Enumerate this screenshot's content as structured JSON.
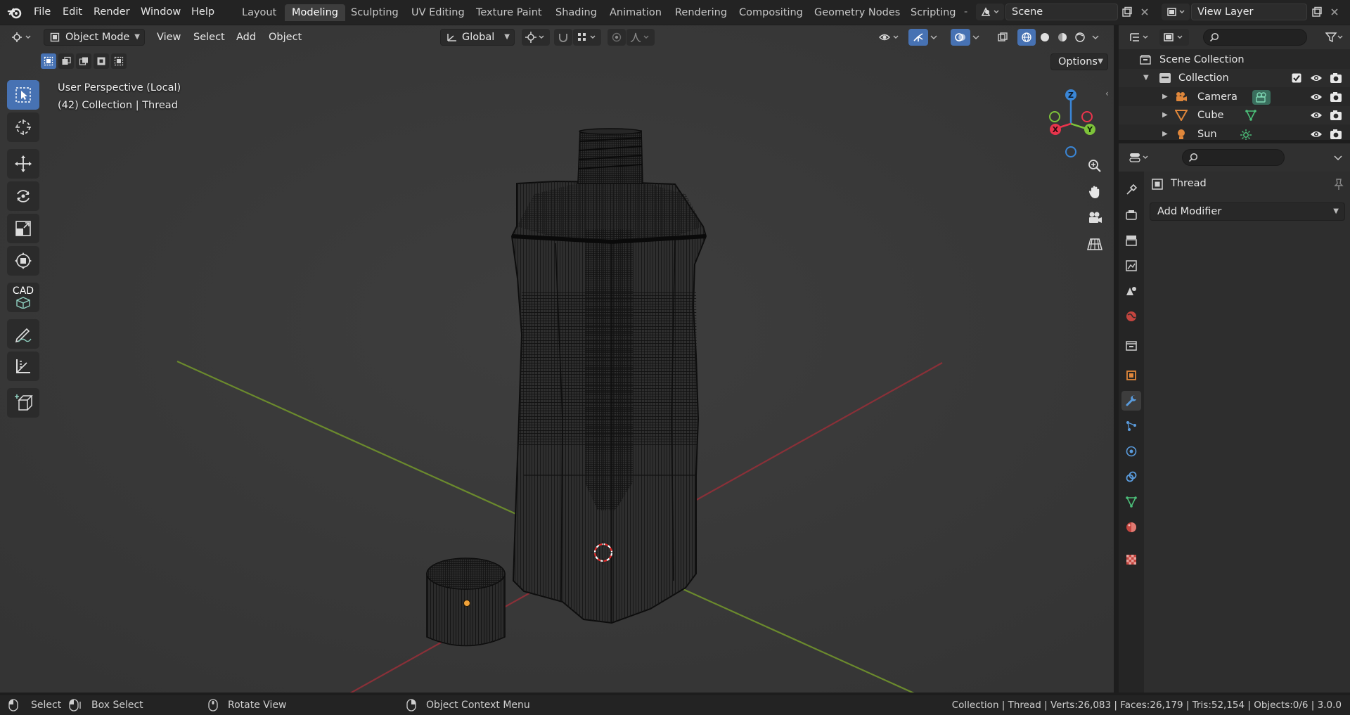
{
  "topbar": {
    "menus": [
      "File",
      "Edit",
      "Render",
      "Window",
      "Help"
    ],
    "workspaces": [
      "Layout",
      "Modeling",
      "Sculpting",
      "UV Editing",
      "Texture Paint",
      "Shading",
      "Animation",
      "Rendering",
      "Compositing",
      "Geometry Nodes",
      "Scripting"
    ],
    "active_workspace": "Modeling",
    "more_tabs": "-",
    "scene_name": "Scene",
    "view_layer_name": "View Layer"
  },
  "viewport_header": {
    "mode": "Object Mode",
    "menus": [
      "View",
      "Select",
      "Add",
      "Object"
    ],
    "orientation": "Global"
  },
  "viewport": {
    "perspective_label": "User Perspective (Local)",
    "collection_label": "(42) Collection | Thread",
    "options_label": "Options",
    "gizmo": {
      "z": "Z",
      "x": "X",
      "y": "Y"
    },
    "cad_label": "CAD"
  },
  "outliner": {
    "root": "Scene Collection",
    "collection": "Collection",
    "items": [
      {
        "name": "Camera",
        "icon": "camera-icon",
        "color": "#e0873b"
      },
      {
        "name": "Cube",
        "icon": "mesh-icon",
        "color": "#e0873b"
      },
      {
        "name": "Sun",
        "icon": "light-icon",
        "color": "#e0873b"
      }
    ]
  },
  "properties": {
    "object_name": "Thread",
    "add_modifier_label": "Add Modifier"
  },
  "statusbar": {
    "select": "Select",
    "box_select": "Box Select",
    "rotate_view": "Rotate View",
    "context_menu": "Object Context Menu",
    "stats": "Collection | Thread | Verts:26,083 | Faces:26,179 | Tris:52,154 | Objects:0/6 | 3.0.0"
  },
  "colors": {
    "accent": "#4772b3",
    "axis_x": "#e8344c",
    "axis_y": "#7ec33a",
    "axis_z": "#3a86d6",
    "origin": "#f2a33a"
  }
}
